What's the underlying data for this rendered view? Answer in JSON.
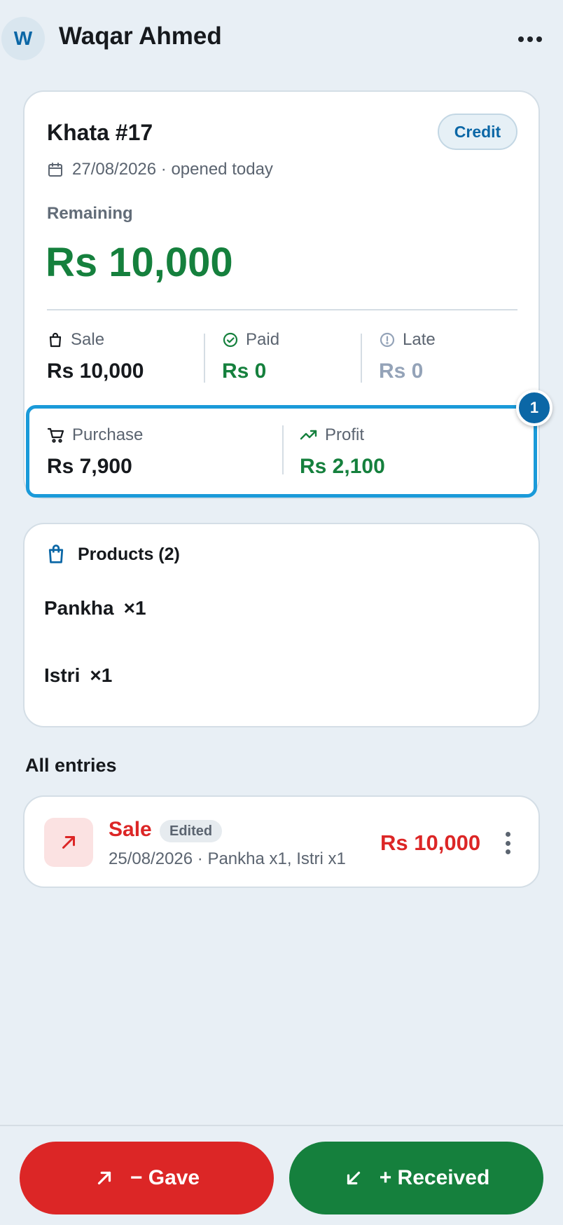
{
  "header": {
    "avatar_initial": "W",
    "customer_name": "Waqar Ahmed",
    "more_icon": "more-horizontal-icon"
  },
  "khata": {
    "title": "Khata #17",
    "badge": "Credit",
    "date": "27/08/2026 · opened today",
    "remaining_label": "Remaining",
    "remaining_value": "Rs 10,000",
    "stats": [
      {
        "label": "Sale",
        "value": "Rs 10,000",
        "icon": "shopping-bag-icon",
        "color": "#16191d"
      },
      {
        "label": "Paid",
        "value": "Rs 0",
        "icon": "check-circle-icon",
        "color": "#15803d"
      },
      {
        "label": "Late",
        "value": "Rs 0",
        "icon": "alert-circle-icon",
        "color": "#94a3b8"
      }
    ],
    "profit": {
      "purchase_label": "Purchase",
      "purchase_value": "Rs 7,900",
      "profit_label": "Profit",
      "profit_value": "Rs 2,100"
    },
    "step_badge": "1"
  },
  "products": {
    "heading": "Products (2)",
    "items": [
      {
        "name": "Pankha",
        "qty": "×1"
      },
      {
        "name": "Istri",
        "qty": "×1"
      }
    ]
  },
  "entries": {
    "heading": "All entries",
    "items": [
      {
        "type": "Sale",
        "badge": "Edited",
        "meta": "25/08/2026 · Pankha x1, Istri x1",
        "amount": "Rs 10,000"
      }
    ]
  },
  "actions": {
    "gave_label": "− Gave",
    "received_label": "+ Received"
  },
  "colors": {
    "brand": "#0b67a6",
    "positive": "#15803d",
    "negative": "#dc2626",
    "highlight": "#1a9ad9"
  }
}
